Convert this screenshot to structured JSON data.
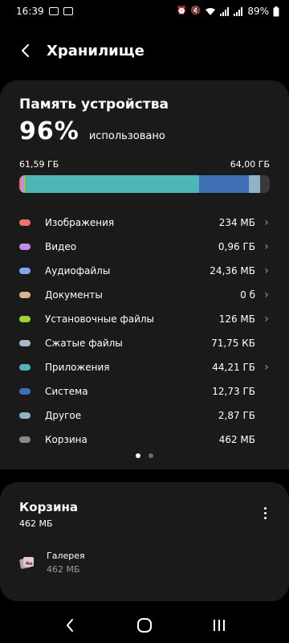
{
  "status_bar": {
    "time": "16:39",
    "battery": "89%"
  },
  "header": {
    "title": "Хранилище"
  },
  "storage": {
    "title": "Память устройства",
    "percent": "96%",
    "percent_label": "использовано",
    "used": "61,59 ГБ",
    "total": "64,00 ГБ",
    "usage_fraction": 0.962
  },
  "categories": [
    {
      "label": "Изображения",
      "value": "234 МБ",
      "color": "#e8756e",
      "has_arrow": true
    },
    {
      "label": "Видео",
      "value": "0,96 ГБ",
      "color": "#c58be8",
      "has_arrow": true
    },
    {
      "label": "Аудиофайлы",
      "value": "24,36 МБ",
      "color": "#7ea6f2",
      "has_arrow": true
    },
    {
      "label": "Документы",
      "value": "0 б",
      "color": "#d9b48c",
      "has_arrow": true
    },
    {
      "label": "Установочные файлы",
      "value": "126 МБ",
      "color": "#9fd62e",
      "has_arrow": true
    },
    {
      "label": "Сжатые файлы",
      "value": "71,75 КБ",
      "color": "#a9b6cc",
      "has_arrow": false
    },
    {
      "label": "Приложения",
      "value": "44,21 ГБ",
      "color": "#4fb6b8",
      "has_arrow": true
    },
    {
      "label": "Система",
      "value": "12,73 ГБ",
      "color": "#3e6fb3",
      "has_arrow": false
    },
    {
      "label": "Другое",
      "value": "2,87 ГБ",
      "color": "#8fb3c4",
      "has_arrow": false
    },
    {
      "label": "Корзина",
      "value": "462 МБ",
      "color": "#8a8a8a",
      "has_arrow": false
    }
  ],
  "trash": {
    "title": "Корзина",
    "size": "462 МБ",
    "items": [
      {
        "name": "Галерея",
        "size": "462 МБ"
      }
    ]
  },
  "colors": {
    "background": "#000000",
    "card": "#1a1a1a",
    "bar_track": "#3a3a3a"
  }
}
